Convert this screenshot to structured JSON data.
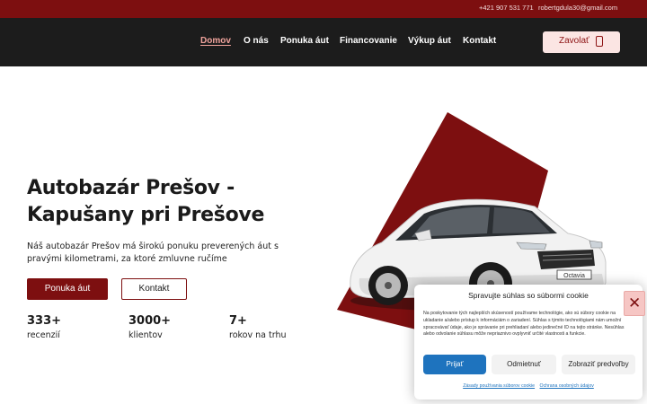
{
  "topbar": {
    "phone": "+421 907 531 771",
    "email": "robertgdula30@gmail.com"
  },
  "nav": {
    "items": [
      {
        "label": "Domov",
        "active": true
      },
      {
        "label": "O nás"
      },
      {
        "label": "Ponuka áut"
      },
      {
        "label": "Financovanie"
      },
      {
        "label": "Výkup áut"
      },
      {
        "label": "Kontakt"
      }
    ],
    "call_label": "Zavolať",
    "call_icon": "phone-icon"
  },
  "hero": {
    "title_line1": "Autobazár Prešov -",
    "title_line2": "Kapušany pri Prešove",
    "subtitle": "Náš autobazár Prešov má širokú ponuku preverených áut s pravými kilometrami, za ktoré zmluvne ručíme",
    "primary_button": "Ponuka áut",
    "secondary_button": "Kontakt",
    "car_plate": "Octavia"
  },
  "stats": [
    {
      "value": "333+",
      "label": "recenzií"
    },
    {
      "value": "3000+",
      "label": "klientov"
    },
    {
      "value": "7+",
      "label": "rokov na trhu"
    }
  ],
  "cookie": {
    "title": "Spravujte súhlas so súbormi cookie",
    "text": "Na poskytovanie tých najlepších skúseností používame technológie, ako sú súbory cookie na ukladanie a/alebo prístup k informáciám o zariadení. Súhlas s týmito technológiami nám umožní spracovávať údaje, ako je správanie pri prehliadaní alebo jedinečné ID na tejto stránke. Nesúhlas alebo odvolanie súhlasu môže nepriaznivo ovplyvniť určité vlastnosti a funkcie.",
    "accept": "Prijať",
    "deny": "Odmietnuť",
    "preferences": "Zobraziť predvoľby",
    "link_policy": "Zásady používania súborov cookie",
    "link_privacy": "Ochrana osobných údajov",
    "close_icon": "close-icon"
  },
  "colors": {
    "brand_red": "#7d0f10",
    "nav_bg": "#1c1c1c",
    "accent_blue": "#1e73be"
  }
}
